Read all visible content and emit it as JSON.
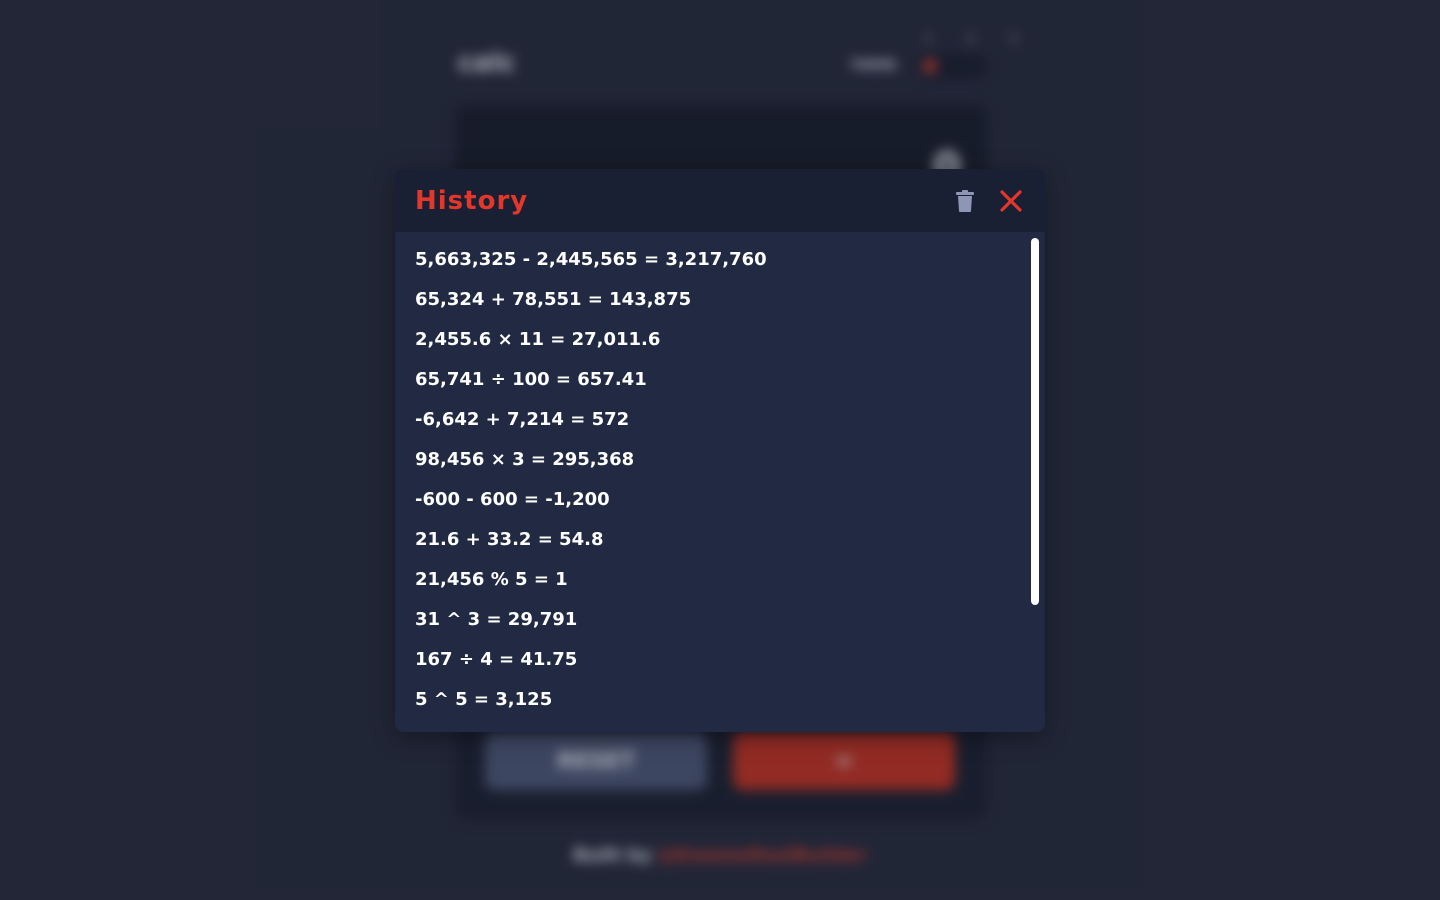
{
  "background_app": {
    "logo": "calc",
    "theme_label": "THEME",
    "theme_numbers": "1 2 3",
    "display_value": "0",
    "reset_label": "RESET",
    "equals_label": "=",
    "footer_prefix": "Built by",
    "footer_author": "@KwameRealBuilder"
  },
  "history": {
    "title": "History",
    "clear_icon": "trash-icon",
    "close_icon": "close-icon",
    "entries": [
      "5,663,325 - 2,445,565 = 3,217,760",
      "65,324 + 78,551 = 143,875",
      "2,455.6 × 11 = 27,011.6",
      "65,741 ÷ 100 = 657.41",
      "-6,642 + 7,214 = 572",
      "98,456 × 3 = 295,368",
      "-600 - 600 = -1,200",
      "21.6 + 33.2 = 54.8",
      "21,456 % 5 = 1",
      "31 ^ 3 = 29,791",
      "167 ÷ 4 = 41.75",
      "5 ^ 5 = 3,125"
    ]
  },
  "colors": {
    "page_background": "#262b3d",
    "modal_background": "#222a43",
    "header_background": "#1a2033",
    "accent_red": "#e4372b",
    "trash_icon": "#8d97b5",
    "text": "#ffffff"
  }
}
